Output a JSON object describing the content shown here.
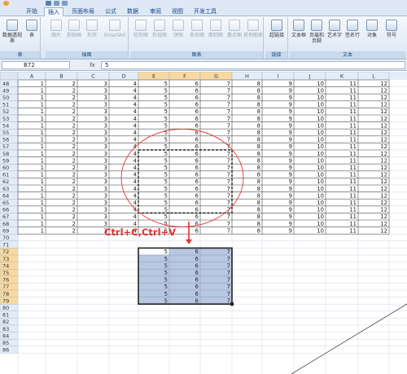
{
  "ribbon": {
    "tabs": [
      {
        "label": "开始",
        "active": false
      },
      {
        "label": "插入",
        "active": true
      },
      {
        "label": "页面布局",
        "active": false
      },
      {
        "label": "公式",
        "active": false
      },
      {
        "label": "数据",
        "active": false
      },
      {
        "label": "审阅",
        "active": false
      },
      {
        "label": "视图",
        "active": false
      },
      {
        "label": "开发工具",
        "active": false
      }
    ],
    "groups": [
      {
        "label": "表",
        "buttons": [
          "数据透视表",
          "表"
        ]
      },
      {
        "label": "插图",
        "buttons": [
          "图片",
          "剪贴画",
          "形状",
          "SmartArt"
        ]
      },
      {
        "label": "图表",
        "buttons": [
          "柱形图",
          "折线图",
          "饼图",
          "条形图",
          "面积图",
          "散点图",
          "其他图表"
        ]
      },
      {
        "label": "链接",
        "buttons": [
          "超链接"
        ]
      },
      {
        "label": "文本",
        "buttons": [
          "文本框",
          "页眉和页脚",
          "艺术字",
          "签名行",
          "对象",
          "符号"
        ]
      }
    ]
  },
  "formula_bar": {
    "name_box": "B72",
    "fx": "fx",
    "formula": "5"
  },
  "sheet": {
    "columns": [
      "A",
      "B",
      "C",
      "D",
      "E",
      "F",
      "G",
      "H",
      "I",
      "J",
      "K",
      "L"
    ],
    "highlighted_columns": [
      "E",
      "F",
      "G"
    ],
    "first_row": 48,
    "last_data_row": 69,
    "last_row": 86,
    "row_values": [
      1,
      2,
      3,
      4,
      5,
      6,
      7,
      8,
      9,
      10,
      11,
      12
    ],
    "copied_rows": [
      58,
      66
    ],
    "paste_block": {
      "first_row": 72,
      "last_row": 79,
      "values": [
        5,
        6,
        7
      ]
    },
    "highlighted_rows": [
      72,
      73,
      74,
      75,
      76,
      77,
      78,
      79
    ]
  },
  "annotation": {
    "text": "Ctrl+C,Ctrl+V",
    "color": "#e53030"
  },
  "colors": {
    "header_bg": "#e4ecf7",
    "header_highlight": "#f9d99f",
    "gridline": "#d0d7e5",
    "ribbon_text": "#15428b"
  }
}
